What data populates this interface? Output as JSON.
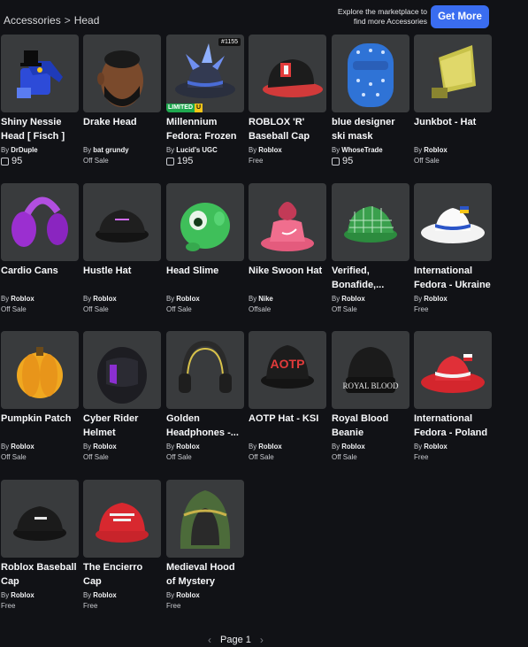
{
  "breadcrumb": {
    "category": "Accessories",
    "separator": ">",
    "current": "Head"
  },
  "promo": {
    "text": "Explore the marketplace to find more Accessories",
    "button": "Get More"
  },
  "items": [
    {
      "name": "Shiny Nessie Head [ Fisch ]",
      "by": "By",
      "creator": "DrDuple",
      "status": "",
      "price": "95",
      "icon": "nessie-head"
    },
    {
      "name": "Drake Head",
      "by": "By",
      "creator": "bat grundy",
      "status": "Off Sale",
      "price": "",
      "icon": "drake-head"
    },
    {
      "name": "Millennium Fedora: Frozen",
      "by": "By",
      "creator": "Lucid's UGC",
      "status": "",
      "price": "195",
      "icon": "fedora",
      "badge_left": "LIMITED",
      "badge_right": "U",
      "count": "#1155"
    },
    {
      "name": "ROBLOX 'R' Baseball Cap",
      "by": "By",
      "creator": "Roblox",
      "status": "Free",
      "price": "",
      "icon": "r-cap"
    },
    {
      "name": "blue designer ski mask",
      "by": "By",
      "creator": "WhoseTrade",
      "status": "",
      "price": "95",
      "icon": "ski-mask"
    },
    {
      "name": "Junkbot - Hat",
      "by": "By",
      "creator": "Roblox",
      "status": "Off Sale",
      "price": "",
      "icon": "junkbot-hat"
    },
    {
      "name": "Cardio Cans",
      "by": "By",
      "creator": "Roblox",
      "status": "Off Sale",
      "price": "",
      "icon": "earmuffs"
    },
    {
      "name": "Hustle Hat",
      "by": "By",
      "creator": "Roblox",
      "status": "Off Sale",
      "price": "",
      "icon": "hustle-hat"
    },
    {
      "name": "Head Slime",
      "by": "By",
      "creator": "Roblox",
      "status": "Off Sale",
      "price": "",
      "icon": "slime"
    },
    {
      "name": "Nike Swoon Hat",
      "by": "By",
      "creator": "Nike",
      "status": "Offsale",
      "price": "",
      "icon": "bucket-hat"
    },
    {
      "name": "Verified, Bonafide,...",
      "by": "By",
      "creator": "Roblox",
      "status": "Off Sale",
      "price": "",
      "icon": "plaid-cap"
    },
    {
      "name": "International Fedora - Ukraine",
      "by": "By",
      "creator": "Roblox",
      "status": "Free",
      "price": "",
      "icon": "fedora-ukraine"
    },
    {
      "name": "Pumpkin Patch",
      "by": "By",
      "creator": "Roblox",
      "status": "Off Sale",
      "price": "",
      "icon": "pumpkin"
    },
    {
      "name": "Cyber Rider Helmet",
      "by": "By",
      "creator": "Roblox",
      "status": "Off Sale",
      "price": "",
      "icon": "helmet"
    },
    {
      "name": "Golden Headphones -...",
      "by": "By",
      "creator": "Roblox",
      "status": "Off Sale",
      "price": "",
      "icon": "headphones"
    },
    {
      "name": "AOTP Hat - KSI",
      "by": "By",
      "creator": "Roblox",
      "status": "Off Sale",
      "price": "",
      "icon": "aotp-cap"
    },
    {
      "name": "Royal Blood Beanie",
      "by": "By",
      "creator": "Roblox",
      "status": "Off Sale",
      "price": "",
      "icon": "beanie"
    },
    {
      "name": "International Fedora - Poland",
      "by": "By",
      "creator": "Roblox",
      "status": "Free",
      "price": "",
      "icon": "fedora-poland"
    },
    {
      "name": "Roblox Baseball Cap",
      "by": "By",
      "creator": "Roblox",
      "status": "Free",
      "price": "",
      "icon": "black-cap"
    },
    {
      "name": "The Encierro Cap",
      "by": "By",
      "creator": "Roblox",
      "status": "Free",
      "price": "",
      "icon": "red-cap"
    },
    {
      "name": "Medieval Hood of Mystery",
      "by": "By",
      "creator": "Roblox",
      "status": "Free",
      "price": "",
      "icon": "hood"
    }
  ],
  "pagination": {
    "prev": "‹",
    "label": "Page 1",
    "next": "›"
  }
}
